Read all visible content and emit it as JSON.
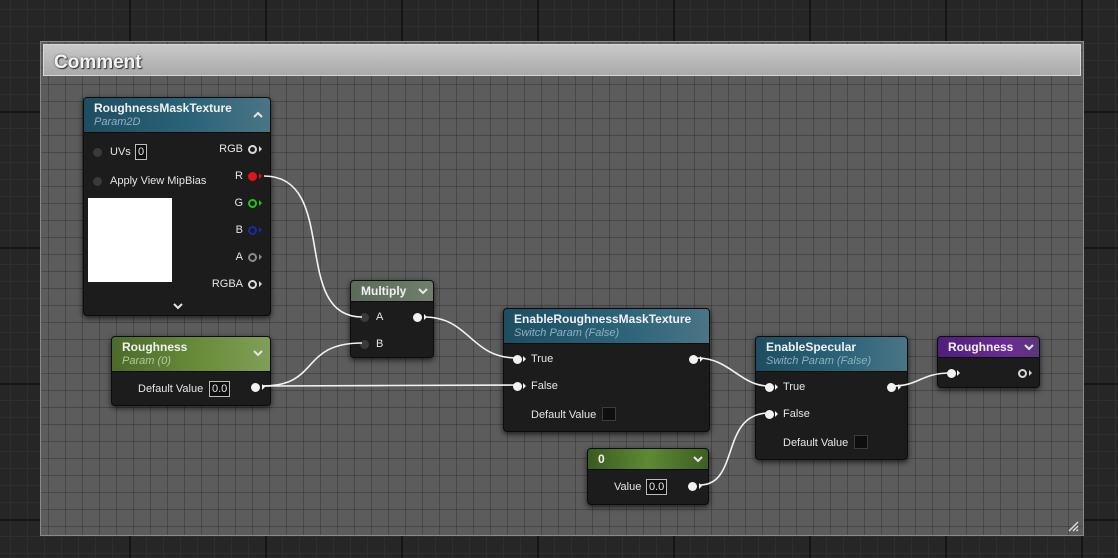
{
  "comment": {
    "title": "Comment"
  },
  "nodes": {
    "texture": {
      "title": "RoughnessMaskTexture",
      "subtitle": "Param2D",
      "inputs": {
        "uvs_label": "UVs",
        "uvs_value": "0",
        "mipbias_label": "Apply View MipBias"
      },
      "outputs": {
        "rgb": "RGB",
        "r": "R",
        "g": "G",
        "b": "B",
        "a": "A",
        "rgba": "RGBA"
      }
    },
    "roughness_param": {
      "title": "Roughness",
      "subtitle": "Param (0)",
      "default_label": "Default Value",
      "default_value": "0.0"
    },
    "multiply": {
      "title": "Multiply",
      "a_label": "A",
      "b_label": "B"
    },
    "switch_mask": {
      "title": "EnableRoughnessMaskTexture",
      "subtitle": "Switch Param (False)",
      "true_label": "True",
      "false_label": "False",
      "default_label": "Default Value"
    },
    "switch_specular": {
      "title": "EnableSpecular",
      "subtitle": "Switch Param (False)",
      "true_label": "True",
      "false_label": "False",
      "default_label": "Default Value"
    },
    "constant": {
      "title": "0",
      "value_label": "Value",
      "value": "0.0"
    },
    "reroute": {
      "title": "Roughness"
    }
  },
  "colors": {
    "pin_r": "#e01515",
    "pin_g": "#22c022",
    "pin_b": "#1a2aa8",
    "wire": "#f2f2f2"
  },
  "icons": [
    "collapse-up-icon",
    "expand-down-icon",
    "chevron-down-icon",
    "resize-grip-icon"
  ]
}
